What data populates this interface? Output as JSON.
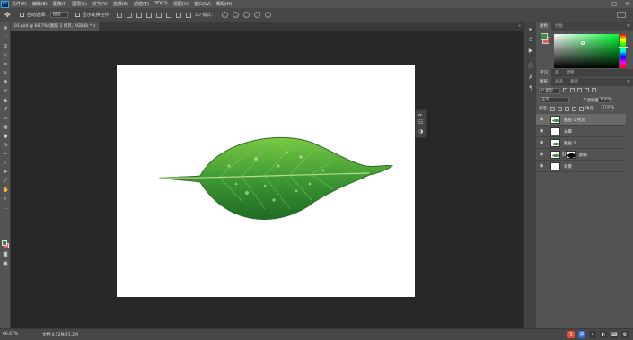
{
  "app": {
    "logo": "Ps"
  },
  "menu": [
    "文件(F)",
    "编辑(E)",
    "图像(I)",
    "图层(L)",
    "文字(Y)",
    "选择(S)",
    "滤镜(T)",
    "3D(D)",
    "视图(V)",
    "窗口(W)",
    "帮助(H)"
  ],
  "window_controls": [
    "—",
    "□",
    "✕"
  ],
  "options": {
    "auto_select_label": "自动选择:",
    "auto_select_value": "图层",
    "show_transform_label": "显示变换控件",
    "mode_3d_label": "3D 模式:"
  },
  "document_tab": {
    "title": "01.psd @ 66.7% (图层 1 拷贝, RGB/8) *",
    "close": "×"
  },
  "status": {
    "zoom": "66.67%",
    "doc_info": "文档:4.52M/21.2M"
  },
  "panels": {
    "color_tabs": [
      "颜色",
      "色板"
    ],
    "style_tabs": [
      "学习",
      "库",
      "调整"
    ],
    "layers_tabs": [
      "图层",
      "通道",
      "路径"
    ],
    "filter_label": "P 类型",
    "blend_mode": "正常",
    "opacity_label": "不透明度:",
    "opacity_value": "100%",
    "lock_label": "锁定:",
    "fill_label": "填充:",
    "fill_value": "100%"
  },
  "layers": [
    {
      "name": "图层 1 拷贝",
      "selected": true,
      "thumb": "leaf",
      "mask": false
    },
    {
      "name": "光晕",
      "selected": false,
      "thumb": "white",
      "mask": false
    },
    {
      "name": "图层 2",
      "selected": false,
      "thumb": "leaf",
      "mask": false
    },
    {
      "name": "颜料",
      "selected": false,
      "thumb": "leaf",
      "mask": true
    },
    {
      "name": "背景",
      "selected": false,
      "thumb": "white",
      "mask": false
    }
  ],
  "colors": {
    "foreground": "#3b8f45",
    "background": "#e06060",
    "leaf_light": "#7ac943",
    "leaf_dark": "#1f6b22"
  },
  "tray_icons": [
    "S",
    "中",
    "•",
    "◐",
    "⌨",
    "⚙"
  ]
}
